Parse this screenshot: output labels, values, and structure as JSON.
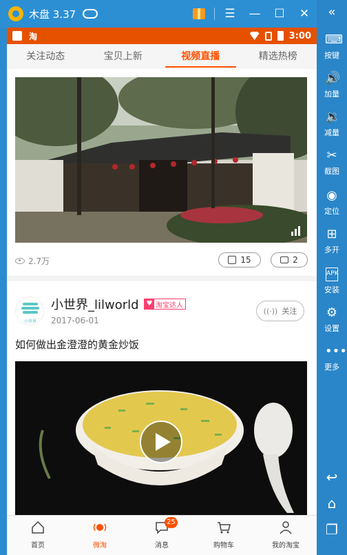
{
  "emulator": {
    "title": "木盘 3.37",
    "controls": [
      "gift-icon",
      "menu-icon",
      "minimize-icon",
      "maximize-icon",
      "close-icon"
    ],
    "sidebar": [
      {
        "label": "按键",
        "icon": "keyboard-icon"
      },
      {
        "label": "加量",
        "icon": "volume-up-icon"
      },
      {
        "label": "减量",
        "icon": "volume-down-icon"
      },
      {
        "label": "截图",
        "icon": "scissors-icon"
      },
      {
        "label": "定位",
        "icon": "location-icon"
      },
      {
        "label": "多开",
        "icon": "multi-open-icon"
      },
      {
        "label": "安装",
        "icon": "apk-icon"
      },
      {
        "label": "设置",
        "icon": "settings-icon"
      },
      {
        "label": "更多",
        "icon": "more-icon"
      }
    ]
  },
  "statusbar": {
    "app": "淘",
    "time": "3:00"
  },
  "tabs": [
    {
      "label": "关注动态",
      "active": false
    },
    {
      "label": "宝贝上新",
      "active": false
    },
    {
      "label": "视频直播",
      "active": true
    },
    {
      "label": "精选热榜",
      "active": false
    }
  ],
  "post1": {
    "views": "2.7万",
    "likes": "15",
    "comments": "2"
  },
  "post2": {
    "author": "小世界_lilworld",
    "badge": "淘宝达人",
    "avatar_text": "小世界",
    "date": "2017-06-01",
    "follow_label": "关注",
    "title": "如何做出金澄澄的黄金炒饭"
  },
  "tabbar": [
    {
      "label": "首页",
      "icon": "home-icon",
      "active": false
    },
    {
      "label": "微淘",
      "icon": "weitao-icon",
      "active": true
    },
    {
      "label": "消息",
      "icon": "message-icon",
      "active": false,
      "badge": "25"
    },
    {
      "label": "购物车",
      "icon": "cart-icon",
      "active": false
    },
    {
      "label": "我的淘宝",
      "icon": "profile-icon",
      "active": false
    }
  ],
  "colors": {
    "accent": "#ff5000",
    "statusbar": "#e65100",
    "emulator": "#2c8fd3"
  }
}
